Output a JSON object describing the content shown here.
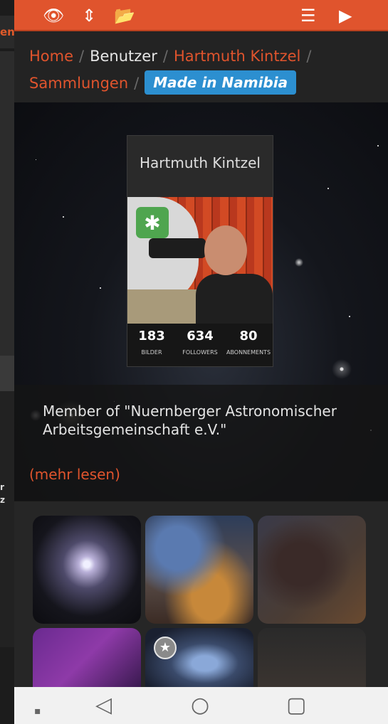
{
  "topbar": {
    "icons": [
      "eye-icon",
      "sort-icon",
      "folder-open-icon",
      "list-icon",
      "play-icon"
    ],
    "glyphs": {
      "eye": "👁",
      "sort": "⇕",
      "folder": "📂",
      "list": "☰",
      "play": "▶"
    }
  },
  "breadcrumb": {
    "home": "Home",
    "users": "Benutzer",
    "user": "Hartmuth Kintzel",
    "collections": "Sammlungen",
    "current": "Made in Namibia",
    "separator": "/"
  },
  "profile": {
    "name": "Hartmuth Kintzel",
    "badge_glyph": "✱",
    "stats": [
      {
        "value": "183",
        "label": "BILDER"
      },
      {
        "value": "634",
        "label": "FOLLOWERS"
      },
      {
        "value": "80",
        "label": "ABONNEMENTS"
      }
    ]
  },
  "bio": {
    "text": "Member of \"Nuernberger Astronomischer Arbeitsgemeinschaft e.V.\"",
    "read_more": "(mehr lesen)"
  },
  "gallery": {
    "star_glyph": "★"
  },
  "behind_app": {
    "tab_text": "en",
    "side_text_1": "r",
    "side_text_2": "z"
  },
  "navbar": {
    "recent_glyph": "▪",
    "back_glyph": "◁",
    "home_glyph": "○",
    "overview_glyph": "▢"
  },
  "colors": {
    "accent": "#e0542d",
    "pill": "#2c8fd0",
    "badge_green": "#4fa54f"
  }
}
